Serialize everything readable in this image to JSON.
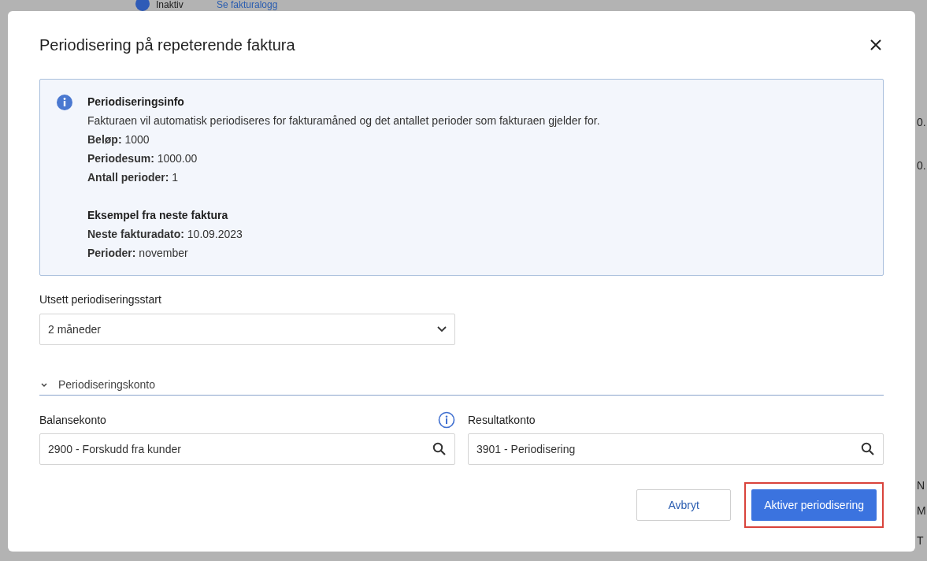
{
  "background": {
    "status": "Inaktiv",
    "log_link": "Se fakturalogg",
    "right_fragments": [
      "0.",
      "0.",
      "N",
      "M",
      "T"
    ]
  },
  "dialog": {
    "title": "Periodisering på repeterende faktura",
    "info": {
      "title": "Periodiseringsinfo",
      "description": "Fakturaen vil automatisk periodiseres for fakturamåned og det antallet perioder som fakturaen gjelder for.",
      "lines": [
        "**Beløp:** 1000",
        "**Periodesum:** 1000.00",
        "**Antall perioder:** 1"
      ],
      "example_title": "Eksempel fra neste faktura",
      "example_lines": [
        "**Neste fakturadato:** 10.09.2023",
        "**Perioder:** november"
      ]
    },
    "delay": {
      "label": "Utsett periodiseringsstart",
      "value": "2 måneder"
    },
    "section": {
      "title": "Periodiseringskonto",
      "expanded": true
    },
    "fields": [
      {
        "label": "Balansekonto",
        "value": "2900 - Forskudd fra kunder",
        "info": true
      },
      {
        "label": "Resultatkonto",
        "value": "3901 - Periodisering",
        "info": false
      }
    ],
    "buttons": [
      {
        "label": "Avbryt",
        "kind": "secondary",
        "highlighted": false
      },
      {
        "label": "Aktiver periodisering",
        "kind": "primary",
        "highlighted": true
      }
    ]
  }
}
